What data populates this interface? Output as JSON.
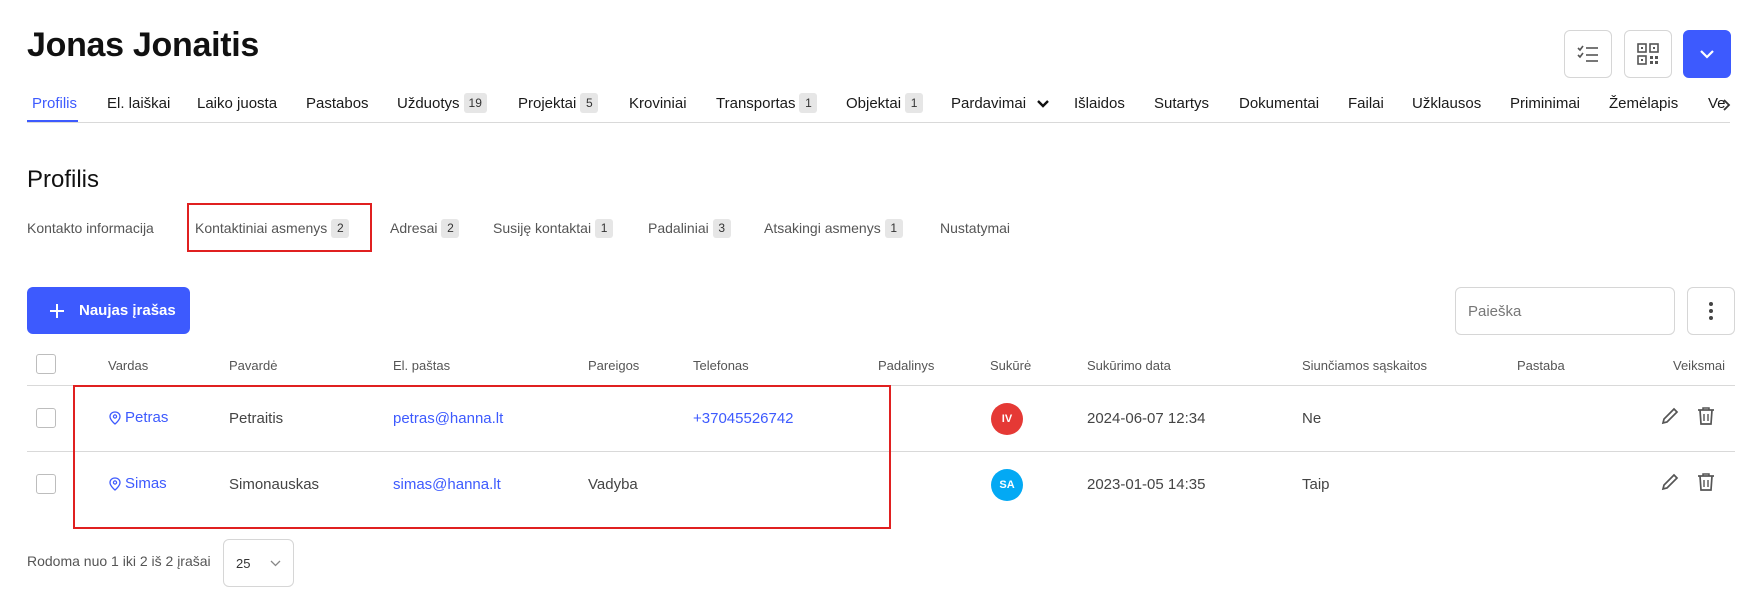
{
  "header": {
    "title": "Jonas Jonaitis"
  },
  "tabs": [
    {
      "label": "Profilis",
      "badge": null
    },
    {
      "label": "El. laiškai",
      "badge": null
    },
    {
      "label": "Laiko juosta",
      "badge": null
    },
    {
      "label": "Pastabos",
      "badge": null
    },
    {
      "label": "Užduotys",
      "badge": "19"
    },
    {
      "label": "Projektai",
      "badge": "5"
    },
    {
      "label": "Kroviniai",
      "badge": null
    },
    {
      "label": "Transportas",
      "badge": "1"
    },
    {
      "label": "Objektai",
      "badge": "1"
    },
    {
      "label": "Pardavimai",
      "badge": null
    },
    {
      "label": "Išlaidos",
      "badge": null
    },
    {
      "label": "Sutartys",
      "badge": null
    },
    {
      "label": "Dokumentai",
      "badge": null
    },
    {
      "label": "Failai",
      "badge": null
    },
    {
      "label": "Užklausos",
      "badge": null
    },
    {
      "label": "Priminimai",
      "badge": null
    },
    {
      "label": "Žemėlapis",
      "badge": null
    },
    {
      "label": "Ve",
      "badge": null
    }
  ],
  "section": {
    "title": "Profilis"
  },
  "subtabs": [
    {
      "label": "Kontakto informacija",
      "badge": null
    },
    {
      "label": "Kontaktiniai asmenys",
      "badge": "2"
    },
    {
      "label": "Adresai",
      "badge": "2"
    },
    {
      "label": "Susiję kontaktai",
      "badge": "1"
    },
    {
      "label": "Padaliniai",
      "badge": "3"
    },
    {
      "label": "Atsakingi asmenys",
      "badge": "1"
    },
    {
      "label": "Nustatymai",
      "badge": null
    }
  ],
  "toolbar": {
    "new_label": "Naujas įrašas",
    "search_placeholder": "Paieška"
  },
  "table": {
    "columns": [
      "Vardas",
      "Pavardė",
      "El. paštas",
      "Pareigos",
      "Telefonas",
      "Padalinys",
      "Sukūrė",
      "Sukūrimo data",
      "Siunčiamos sąskaitos",
      "Pastaba",
      "Veiksmai"
    ],
    "rows": [
      {
        "vardas": "Petras",
        "pavarde": "Petraitis",
        "email": "petras@hanna.lt",
        "pareigos": "",
        "telefonas": "+37045526742",
        "padalinys": "",
        "sukure": "IV",
        "sukure_color": "#e53935",
        "data": "2024-06-07 12:34",
        "saskaitos": "Ne",
        "pastaba": ""
      },
      {
        "vardas": "Simas",
        "pavarde": "Simonauskas",
        "email": "simas@hanna.lt",
        "pareigos": "Vadyba",
        "telefonas": "",
        "padalinys": "",
        "sukure": "SA",
        "sukure_color": "#03a9f4",
        "data": "2023-01-05 14:35",
        "saskaitos": "Taip",
        "pastaba": ""
      }
    ]
  },
  "footer": {
    "range_text": "Rodoma nuo 1 iki 2 iš 2 įrašai",
    "page_size": "25"
  },
  "colors": {
    "accent": "#3d5afe",
    "highlight": "#e02020"
  }
}
